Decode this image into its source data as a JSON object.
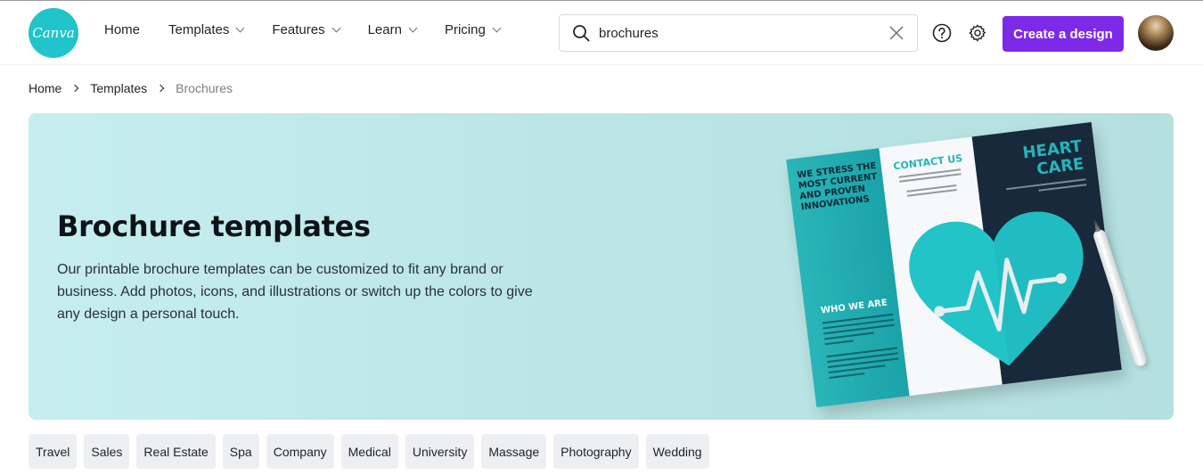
{
  "header": {
    "logo_text": "Canva",
    "nav": [
      {
        "label": "Home",
        "has_dropdown": false
      },
      {
        "label": "Templates",
        "has_dropdown": true
      },
      {
        "label": "Features",
        "has_dropdown": true
      },
      {
        "label": "Learn",
        "has_dropdown": true
      },
      {
        "label": "Pricing",
        "has_dropdown": true
      }
    ],
    "search": {
      "value": "brochures",
      "icon": "search-icon",
      "clear_icon": "close-icon"
    },
    "help_icon": "question-circle-icon",
    "settings_icon": "gear-icon",
    "create_button": "Create a design",
    "accent_color": "#7d2ae8",
    "logo_color": "#20c4cb"
  },
  "breadcrumb": {
    "items": [
      "Home",
      "Templates"
    ],
    "current": "Brochures"
  },
  "banner": {
    "title": "Brochure templates",
    "description": "Our printable brochure templates can be customized to fit any brand or business. Add photos, icons, and illustrations or switch up the colors to give any design a personal touch.",
    "brochure": {
      "panel1_heading": "WE STRESS THE MOST CURRENT AND PROVEN INNOVATIONS",
      "panel1_subheading": "WHO WE ARE",
      "panel2_heading": "CONTACT US",
      "panel3_heading": "HEART CARE"
    }
  },
  "tags": [
    "Travel",
    "Sales",
    "Real Estate",
    "Spa",
    "Company",
    "Medical",
    "University",
    "Massage",
    "Photography",
    "Wedding"
  ]
}
